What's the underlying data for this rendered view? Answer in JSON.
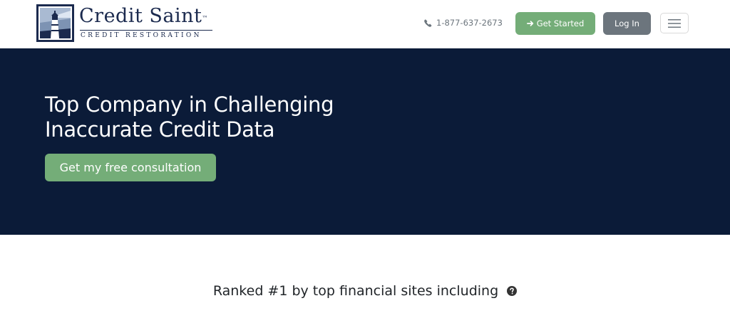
{
  "header": {
    "logo": {
      "name": "Credit Saint",
      "trademark": "™",
      "tagline": "CREDIT RESTORATION"
    },
    "phone": {
      "icon": "phone-icon",
      "number": "1-877-637-2673"
    },
    "get_started": {
      "icon": "arrow-right-icon",
      "label": "Get Started"
    },
    "login_label": "Log In",
    "menu_icon": "hamburger-icon"
  },
  "hero": {
    "title": "Top Company in Challenging Inaccurate Credit Data",
    "cta_label": "Get my free consultation"
  },
  "ranked": {
    "text": "Ranked #1 by top financial sites including",
    "icon": "question-circle-icon"
  },
  "colors": {
    "navy": "#0b1b38",
    "brand_green": "#74ad78",
    "gray_button": "#6c757d",
    "logo_blue": "#1b2a4e"
  }
}
